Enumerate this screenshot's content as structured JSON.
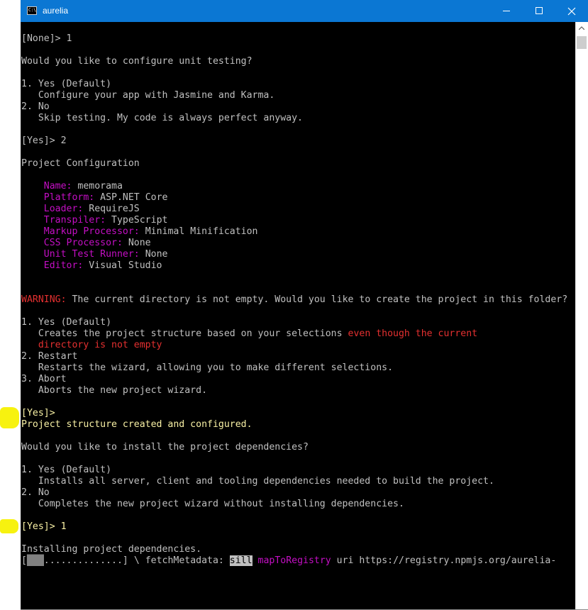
{
  "window": {
    "title": "aurelia",
    "icon_label": "C:\\",
    "controls": [
      "minimize-icon",
      "maximize-icon",
      "close-icon"
    ]
  },
  "colors": {
    "titlebar": "#0b77d3",
    "console_bg": "#000000",
    "text": "#c0c0c0",
    "magenta": "#c50fc5",
    "red": "#e53030",
    "yellow": "#f9f1a5",
    "highlight_marker": "#f7f20f"
  },
  "console": {
    "lines": [
      [
        {
          "t": "[None]> 1"
        }
      ],
      [],
      [
        {
          "t": "Would you like to configure unit testing?"
        }
      ],
      [],
      [
        {
          "t": "1. Yes (Default)"
        }
      ],
      [
        {
          "t": "   Configure your app with Jasmine and Karma."
        }
      ],
      [
        {
          "t": "2. No"
        }
      ],
      [
        {
          "t": "   Skip testing. My code is always perfect anyway."
        }
      ],
      [],
      [
        {
          "t": "[Yes]> 2"
        }
      ],
      [],
      [
        {
          "t": "Project Configuration"
        }
      ],
      [],
      [
        {
          "t": "    "
        },
        {
          "t": "Name:",
          "c": "mg"
        },
        {
          "t": " memorama"
        }
      ],
      [
        {
          "t": "    "
        },
        {
          "t": "Platform:",
          "c": "mg"
        },
        {
          "t": " ASP.NET Core"
        }
      ],
      [
        {
          "t": "    "
        },
        {
          "t": "Loader:",
          "c": "mg"
        },
        {
          "t": " RequireJS"
        }
      ],
      [
        {
          "t": "    "
        },
        {
          "t": "Transpiler:",
          "c": "mg"
        },
        {
          "t": " TypeScript"
        }
      ],
      [
        {
          "t": "    "
        },
        {
          "t": "Markup Processor:",
          "c": "mg"
        },
        {
          "t": " Minimal Minification"
        }
      ],
      [
        {
          "t": "    "
        },
        {
          "t": "CSS Processor:",
          "c": "mg"
        },
        {
          "t": " None"
        }
      ],
      [
        {
          "t": "    "
        },
        {
          "t": "Unit Test Runner:",
          "c": "mg"
        },
        {
          "t": " None"
        }
      ],
      [
        {
          "t": "    "
        },
        {
          "t": "Editor:",
          "c": "mg"
        },
        {
          "t": " Visual Studio"
        }
      ],
      [],
      [],
      [
        {
          "t": "WARNING:",
          "c": "rd"
        },
        {
          "t": " The current directory is not empty. Would you like to create the project in this folder?"
        }
      ],
      [],
      [
        {
          "t": "1. Yes (Default)"
        }
      ],
      [
        {
          "t": "   Creates the project structure based on your selections "
        },
        {
          "t": "even though the current",
          "c": "rd"
        }
      ],
      [
        {
          "t": "   "
        },
        {
          "t": "directory is not empty",
          "c": "rd"
        }
      ],
      [
        {
          "t": "2. Restart"
        }
      ],
      [
        {
          "t": "   Restarts the wizard, allowing you to make different selections."
        }
      ],
      [
        {
          "t": "3. Abort"
        }
      ],
      [
        {
          "t": "   Aborts the new project wizard."
        }
      ],
      [],
      [
        {
          "t": "[Yes]>",
          "c": "yl"
        }
      ],
      [
        {
          "t": "Project structure created and configured.",
          "c": "yl"
        }
      ],
      [],
      [
        {
          "t": "Would you like to install the project dependencies?"
        }
      ],
      [],
      [
        {
          "t": "1. Yes (Default)"
        }
      ],
      [
        {
          "t": "   Installs all server, client and tooling dependencies needed to build the project."
        }
      ],
      [
        {
          "t": "2. No"
        }
      ],
      [
        {
          "t": "   Completes the new project wizard without installing dependencies."
        }
      ],
      [],
      [
        {
          "t": "[Yes]> 1",
          "c": "yl"
        }
      ],
      [],
      [
        {
          "t": "Installing project dependencies."
        }
      ],
      [
        {
          "t": "["
        },
        {
          "t": "███",
          "c": "prog-fill"
        },
        {
          "t": "..............] \\ fetchMetadata: "
        },
        {
          "t": "sill",
          "c": "hl"
        },
        {
          "t": " "
        },
        {
          "t": "mapToRegistry",
          "c": "mg"
        },
        {
          "t": " uri https://registry.npmjs.org/aurelia-"
        }
      ]
    ]
  }
}
